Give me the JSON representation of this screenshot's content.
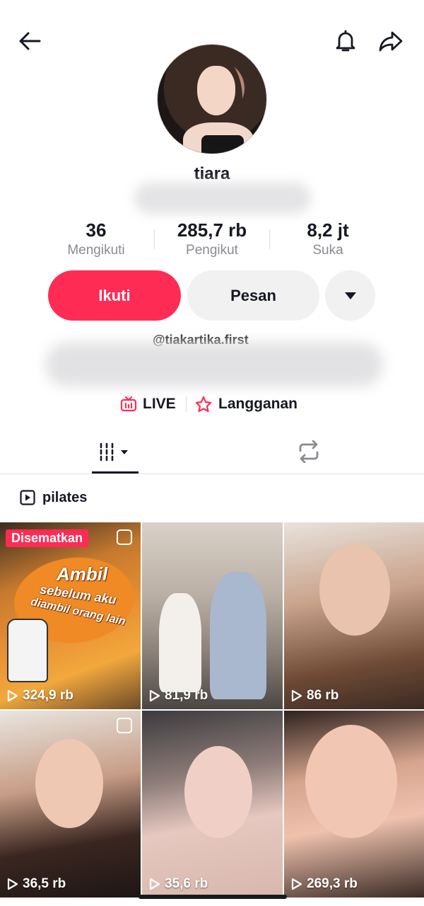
{
  "profile": {
    "username": "tiara",
    "handle": "@tiakartika.first"
  },
  "stats": {
    "following": {
      "value": "36",
      "label": "Mengikuti"
    },
    "followers": {
      "value": "285,7 rb",
      "label": "Pengikut"
    },
    "likes": {
      "value": "8,2 jt",
      "label": "Suka"
    }
  },
  "actions": {
    "follow_label": "Ikuti",
    "message_label": "Pesan"
  },
  "links": {
    "live_label": "LIVE",
    "subscription_label": "Langganan"
  },
  "playlist": {
    "label": "pilates"
  },
  "videos": [
    {
      "views": "324,9 rb",
      "badge": "Disematkan",
      "caption_line1": "Ambil",
      "caption_line2": "sebelum aku",
      "caption_line3": "diambil orang lain"
    },
    {
      "views": "81,9 rb"
    },
    {
      "views": "86 rb"
    },
    {
      "views": "36,5 rb"
    },
    {
      "views": "35,6 rb"
    },
    {
      "views": "269,3 rb"
    }
  ],
  "colors": {
    "accent": "#fe2c55",
    "button_secondary": "#f1f1f2",
    "text_primary": "#161823",
    "text_secondary": "#8a8b91"
  },
  "icons": {
    "back": "back-arrow-icon",
    "notifications": "bell-icon",
    "share": "share-icon",
    "more": "caret-down-icon",
    "live": "live-tv-icon",
    "subscription": "star-icon",
    "videos_tab": "grid-icon",
    "repost_tab": "repost-icon",
    "playlist": "play-square-icon",
    "views": "play-icon"
  }
}
